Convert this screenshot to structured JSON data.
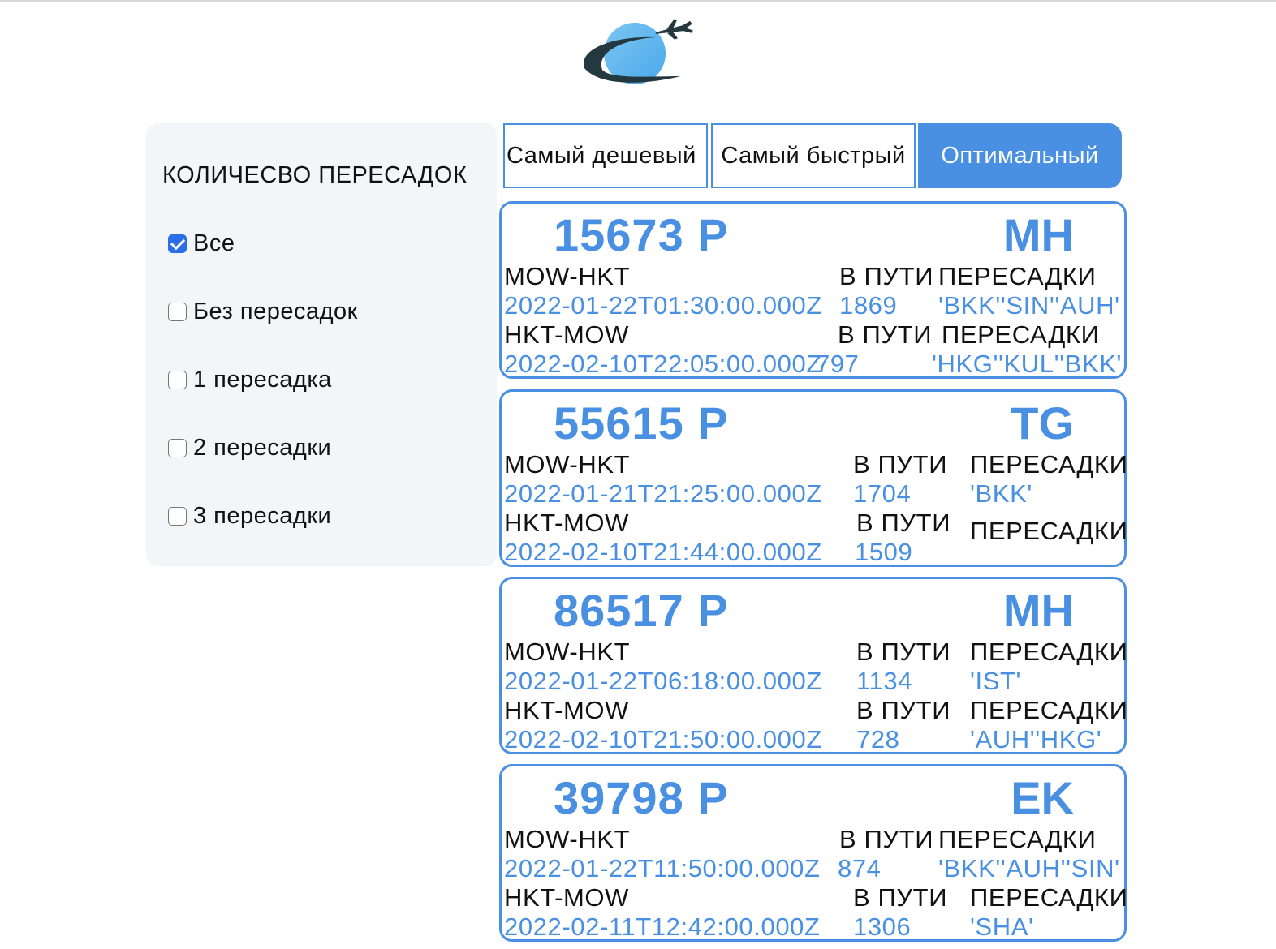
{
  "header": {
    "logo_icon": "plane-globe-logo"
  },
  "filter": {
    "title": "КОЛИЧЕСВО ПЕРЕСАДОК",
    "options": [
      {
        "label": "Все",
        "checked": true
      },
      {
        "label": "Без пересадок",
        "checked": false
      },
      {
        "label": "1 пересадка",
        "checked": false
      },
      {
        "label": "2 пересадки",
        "checked": false
      },
      {
        "label": "3 пересадки",
        "checked": false
      }
    ]
  },
  "tabs": [
    {
      "label": "Самый дешевый",
      "active": false
    },
    {
      "label": "Самый быстрый",
      "active": false
    },
    {
      "label": "Оптимальный",
      "active": true
    }
  ],
  "tickets": [
    {
      "price": "15673 Р",
      "carrier": "MH",
      "segments": [
        {
          "route": "MOW-HKT",
          "date": "2022-01-22T01:30:00.000Z",
          "duration_label": "В ПУТИ",
          "duration": "1869",
          "stops_label": "ПЕРЕСАДКИ",
          "stops": "'BKK''SIN''AUH'"
        },
        {
          "route": "HKT-MOW",
          "date": "2022-02-10T22:05:00.000Z",
          "duration_label": "В ПУТИ",
          "duration": "797",
          "stops_label": "ПЕРЕСАДКИ",
          "stops": "'HKG''KUL''BKK'"
        }
      ]
    },
    {
      "price": "55615 Р",
      "carrier": "TG",
      "segments": [
        {
          "route": "MOW-HKT",
          "date": "2022-01-21T21:25:00.000Z",
          "duration_label": "В ПУТИ",
          "duration": "1704",
          "stops_label": "ПЕРЕСАДКИ",
          "stops": "'BKK'"
        },
        {
          "route": "HKT-MOW",
          "date": "2022-02-10T21:44:00.000Z",
          "duration_label": "В ПУТИ",
          "duration": "1509",
          "stops_label": "ПЕРЕСАДКИ",
          "stops": ""
        }
      ]
    },
    {
      "price": "86517 Р",
      "carrier": "MH",
      "segments": [
        {
          "route": "MOW-HKT",
          "date": "2022-01-22T06:18:00.000Z",
          "duration_label": "В ПУТИ",
          "duration": "1134",
          "stops_label": "ПЕРЕСАДКИ",
          "stops": "'IST'"
        },
        {
          "route": "HKT-MOW",
          "date": "2022-02-10T21:50:00.000Z",
          "duration_label": "В ПУТИ",
          "duration": "728",
          "stops_label": "ПЕРЕСАДКИ",
          "stops": "'AUH''HKG'"
        }
      ]
    },
    {
      "price": "39798 Р",
      "carrier": "EK",
      "segments": [
        {
          "route": "MOW-HKT",
          "date": "2022-01-22T11:50:00.000Z",
          "duration_label": "В ПУТИ",
          "duration": "874",
          "stops_label": "ПЕРЕСАДКИ",
          "stops": "'BKK''AUH''SIN'"
        },
        {
          "route": "HKT-MOW",
          "date": "2022-02-11T12:42:00.000Z",
          "duration_label": "В ПУТИ",
          "duration": "1306",
          "stops_label": "ПЕРЕСАДКИ",
          "stops": "'SHA'"
        }
      ]
    }
  ]
}
